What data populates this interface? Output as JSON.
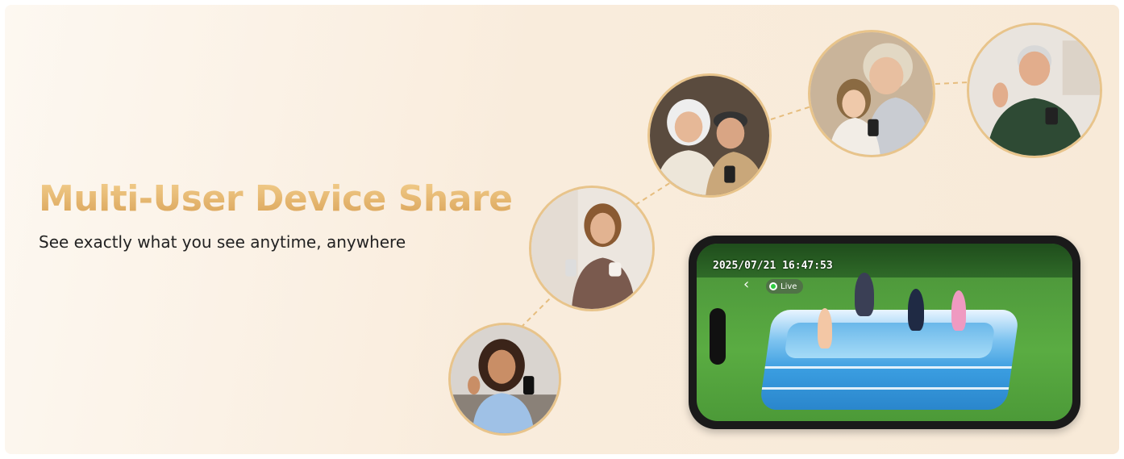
{
  "banner": {
    "title": "Multi-User Device Share",
    "subtitle": "See exactly what you see anytime, anywhere"
  },
  "phone": {
    "timestamp": "2025/07/21 16:47:53",
    "live_label": "Live",
    "back_icon": "chevron-left-icon"
  },
  "avatars": [
    {
      "name": "woman-curly-hair-waving"
    },
    {
      "name": "woman-with-phone-and-cup"
    },
    {
      "name": "elderly-couple-with-phone"
    },
    {
      "name": "grandmother-and-girl-with-phone"
    },
    {
      "name": "elderly-man-waving"
    }
  ],
  "colors": {
    "title_gradient_top": "#f3cf8e",
    "title_gradient_bottom": "#d9a257",
    "avatar_border": "#e8c48b",
    "dash": "#e6bd7e",
    "live_dot": "#2ecc40"
  }
}
